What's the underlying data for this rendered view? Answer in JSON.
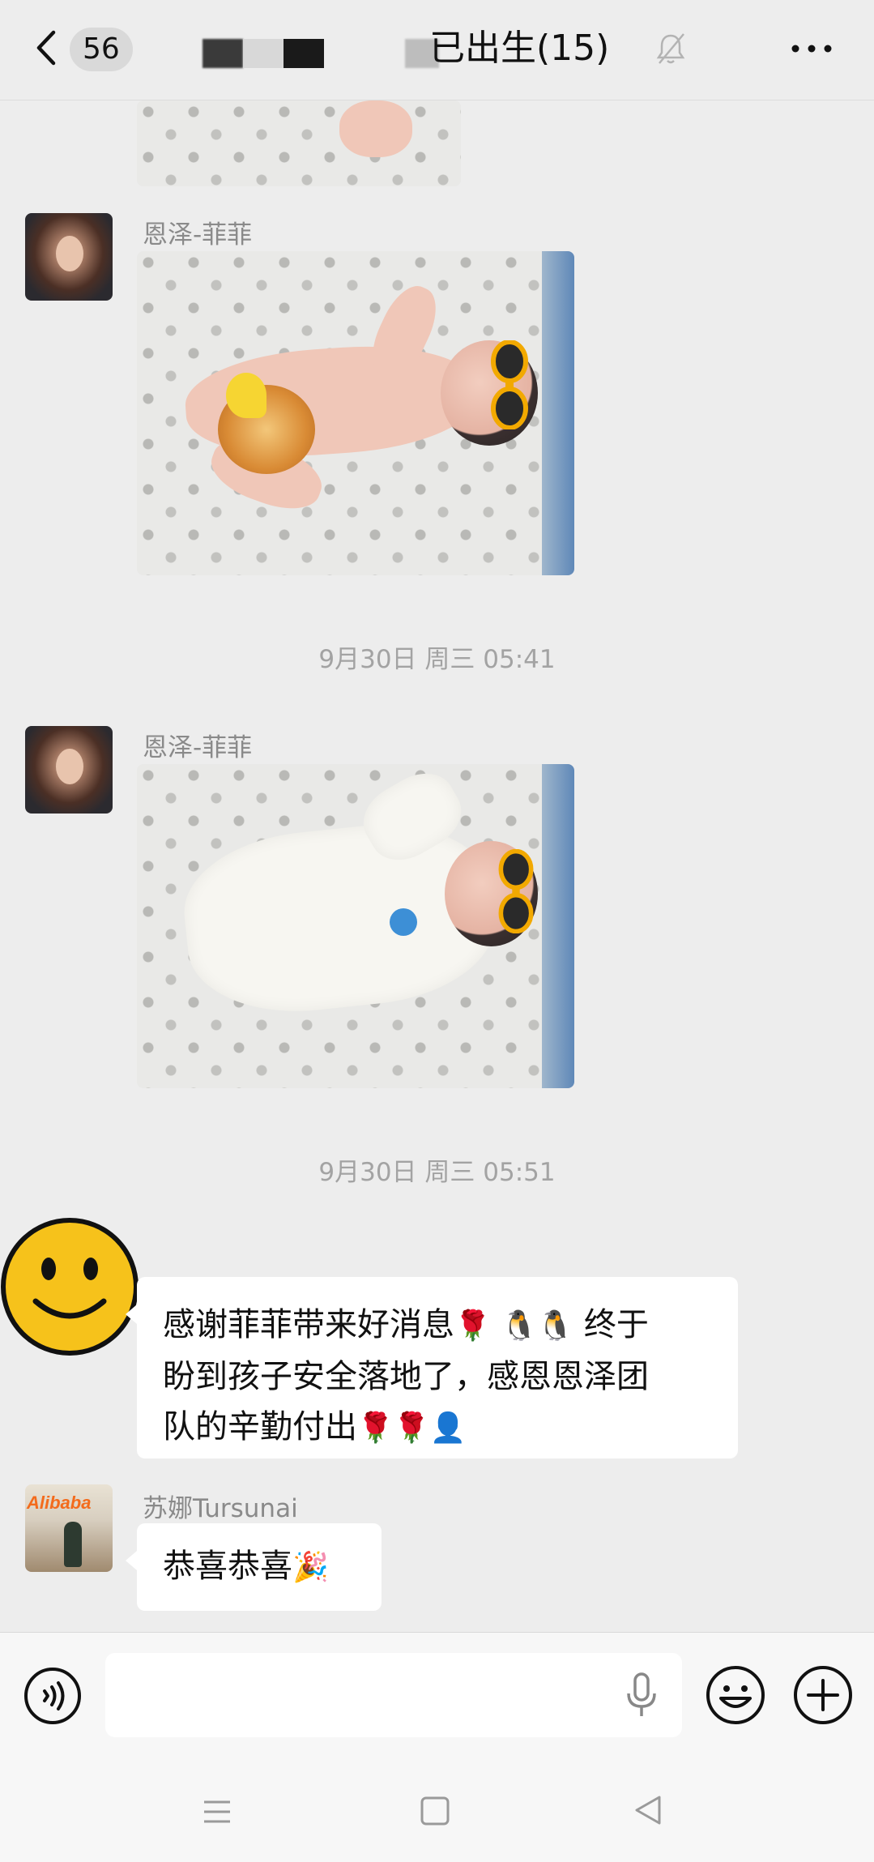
{
  "header": {
    "unread_count": "56",
    "title": "已出生(15)"
  },
  "messages": {
    "ts1": "9月30日 周三 05:41",
    "ts2": "9月30日 周三 05:51",
    "sender_feifei": "恩泽-菲菲",
    "sender_suna": "苏娜Tursunai",
    "msg_thanks_line1_a": "感谢菲菲带来好消息",
    "msg_thanks_line1_b": "终于",
    "msg_thanks_line2": "盼到孩子安全落地了，感恩恩泽团",
    "msg_thanks_line3": "队的辛勤付出",
    "msg_congrats": "恭喜恭喜"
  },
  "avatar_text": {
    "alibaba": "Alibaba"
  },
  "input": {
    "placeholder": ""
  },
  "icons": {
    "back": "chevron-left-icon",
    "mute": "bell-off-icon",
    "more": "more-icon",
    "voice": "voice-icon",
    "mic": "mic-icon",
    "emoji": "emoji-icon",
    "plus": "plus-icon",
    "rose": "🌹",
    "penguin": "🐧",
    "party": "🎉",
    "figure": "👤"
  },
  "colors": {
    "background": "#ededed",
    "bubble": "#ffffff",
    "timestamp": "#a3a3a3",
    "sender": "#8a8a8a",
    "smiley": "#f6c21b"
  }
}
